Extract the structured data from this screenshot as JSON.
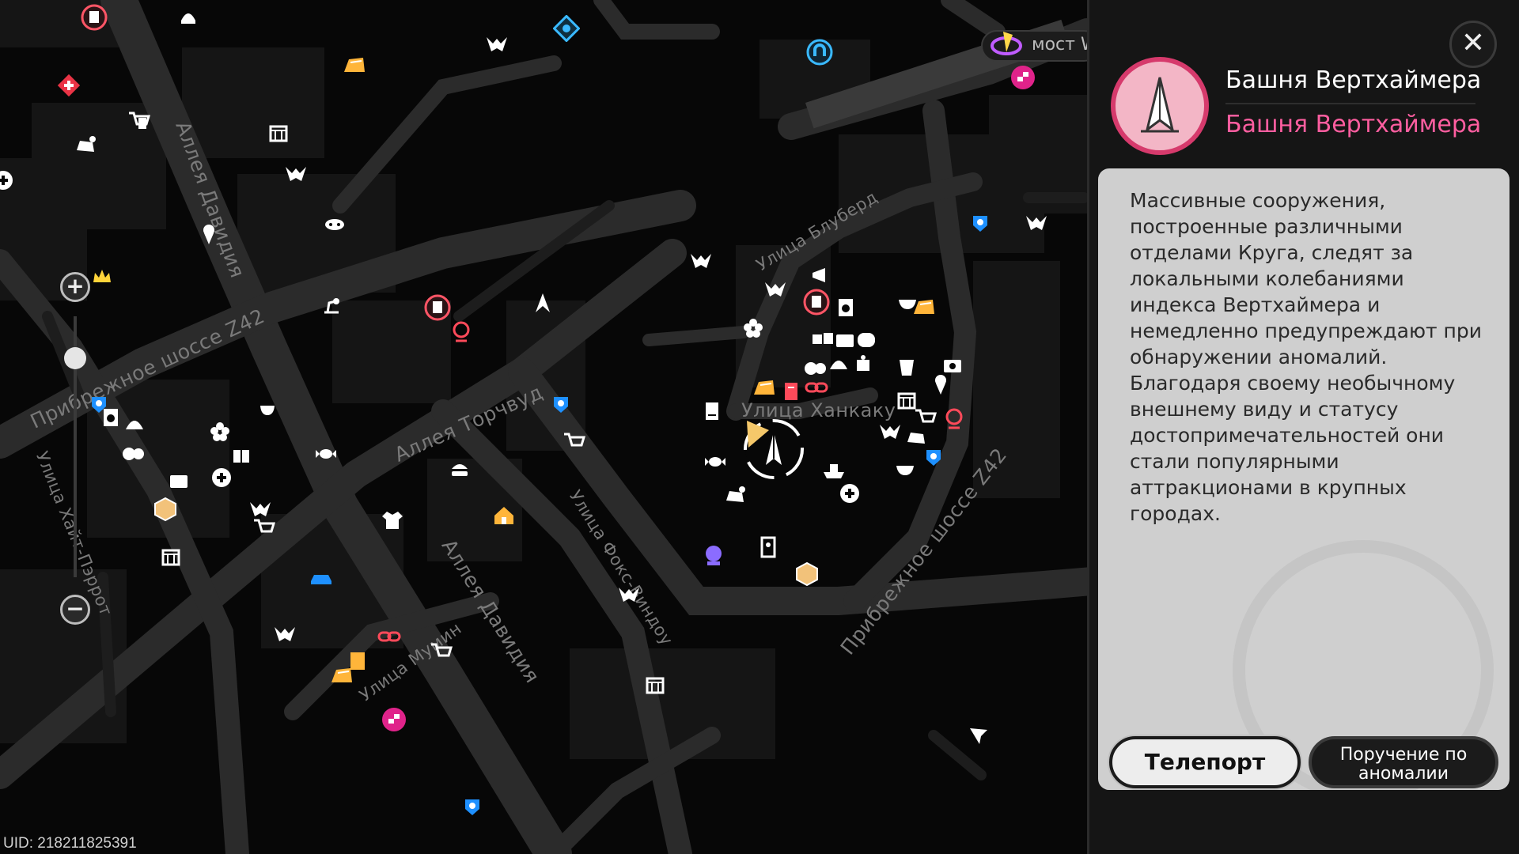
{
  "map": {
    "streets": [
      {
        "key": "s1",
        "label": "Аллея Давидия"
      },
      {
        "key": "s2",
        "label": "Прибрежное шоссе Z42"
      },
      {
        "key": "s3",
        "label": "Аллея Торчвуд"
      },
      {
        "key": "s4",
        "label": "Улица Хайт-Пэррот"
      },
      {
        "key": "s5",
        "label": "Аллея Давидия"
      },
      {
        "key": "s6",
        "label": "Улица Фокс-Виндоу"
      },
      {
        "key": "s7",
        "label": "Улица Мумин"
      },
      {
        "key": "s8",
        "label": "Улица Блуберд"
      },
      {
        "key": "s9",
        "label": "Улица Ханкаку"
      },
      {
        "key": "s10",
        "label": "Прибрежное шоссе Z42"
      },
      {
        "key": "s11",
        "label": "мост W"
      }
    ],
    "top_chip_text": "мост W",
    "uid": "UID: 218211825391"
  },
  "zoom": {
    "in_label": "+",
    "out_label": "−",
    "level": 0.16
  },
  "panel": {
    "close_label": "✕",
    "title": "Башня Вертхаймера",
    "subtitle": "Башня Вертхаймера",
    "description": "Массивные сооружения, построенные различными отделами Круга, следят за локальными колебаниями индекса Вертхаймера и немедленно предупреждают при обнаружении аномалий. Благодаря своему необычному внешнему виду и статусу достопримечательностей они стали популярными аттракционами в крупных городах.",
    "teleport_label": "Телепорт",
    "commission_label": "Поручение по аномалии",
    "accent_color": "#ff5ea0"
  }
}
